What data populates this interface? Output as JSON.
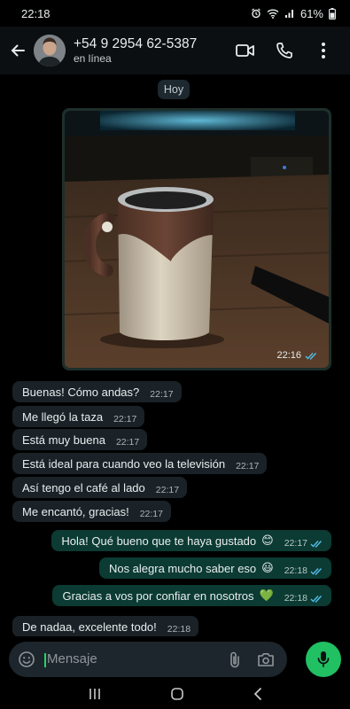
{
  "status_bar": {
    "time": "22:18",
    "battery": "61%"
  },
  "header": {
    "contact_name": "+54 9 2954 62-5387",
    "contact_status": "en línea"
  },
  "chat": {
    "date_chip": "Hoy",
    "image_message": {
      "time": "22:16"
    },
    "messages": [
      {
        "dir": "in",
        "text": "Buenas! Cómo andas?",
        "time": "22:17"
      },
      {
        "dir": "in",
        "text": "Me llegó la taza",
        "time": "22:17"
      },
      {
        "dir": "in",
        "text": "Está muy buena",
        "time": "22:17"
      },
      {
        "dir": "in",
        "text": "Está ideal para cuando veo la televisión",
        "time": "22:17"
      },
      {
        "dir": "in",
        "text": "Así tengo el café al lado",
        "time": "22:17"
      },
      {
        "dir": "in",
        "text": "Me encantó, gracias!",
        "time": "22:17"
      },
      {
        "dir": "out",
        "text": "Hola! Qué bueno que te haya gustado",
        "time": "22:17",
        "emoji": "😊"
      },
      {
        "dir": "out",
        "text": "Nos alegra mucho saber eso",
        "time": "22:18",
        "emoji": "😃"
      },
      {
        "dir": "out",
        "text": "Gracias a vos por confiar en nosotros",
        "time": "22:18",
        "emoji": "💚"
      },
      {
        "dir": "in",
        "text": "De nadaa, excelente todo!",
        "time": "22:18"
      }
    ]
  },
  "composer": {
    "placeholder": "Mensaje"
  },
  "colors": {
    "accent_green": "#21c063",
    "outgoing_bubble": "#0b3b33",
    "incoming_bubble": "#1a2227",
    "read_ticks": "#53bdeb"
  }
}
